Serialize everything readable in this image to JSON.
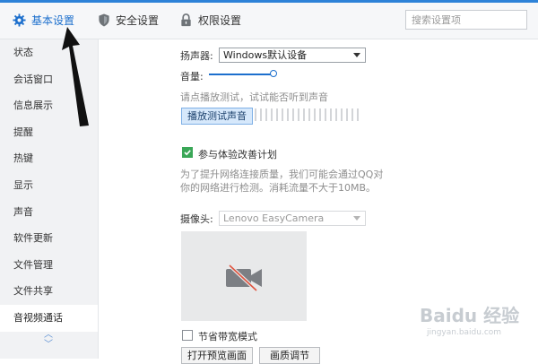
{
  "tabs": [
    {
      "label": "基本设置",
      "icon": "gear-icon",
      "active": true
    },
    {
      "label": "安全设置",
      "icon": "shield-icon",
      "active": false
    },
    {
      "label": "权限设置",
      "icon": "lock-icon",
      "active": false
    }
  ],
  "search": {
    "placeholder": "搜索设置项"
  },
  "sidebar": {
    "items": [
      {
        "label": "状态"
      },
      {
        "label": "会话窗口"
      },
      {
        "label": "信息展示"
      },
      {
        "label": "提醒"
      },
      {
        "label": "热键"
      },
      {
        "label": "显示"
      },
      {
        "label": "声音"
      },
      {
        "label": "软件更新"
      },
      {
        "label": "文件管理"
      },
      {
        "label": "文件共享"
      },
      {
        "label": "音视频通话",
        "active": true
      }
    ]
  },
  "audio": {
    "speaker_label": "扬声器:",
    "speaker_value": "Windows默认设备",
    "volume_label": "音量:",
    "volume_level": 1.0,
    "test_hint": "请点播放测试，试试能否听到声音",
    "play_button": "播放测试声音"
  },
  "experience": {
    "label": "参与体验改善计划",
    "checked": true,
    "description_line1": "为了提升网络连接质量，我们可能会通过QQ对",
    "description_line2": "你的网络进行检测。消耗流量不大于10MB。"
  },
  "camera": {
    "label": "摄像头:",
    "value": "Lenovo EasyCamera",
    "preview_icon": "camera-off-icon"
  },
  "bandwidth": {
    "label": "节省带宽模式",
    "checked": false
  },
  "bottom_buttons": {
    "preview": "打开预览画面",
    "quality": "画质调节"
  },
  "watermark": {
    "brand": "Baidu 经验",
    "url": "jingyan.baidu.com"
  },
  "colors": {
    "accent": "#1c6fcd",
    "check_green": "#3aa757",
    "arrow": "#111111"
  }
}
